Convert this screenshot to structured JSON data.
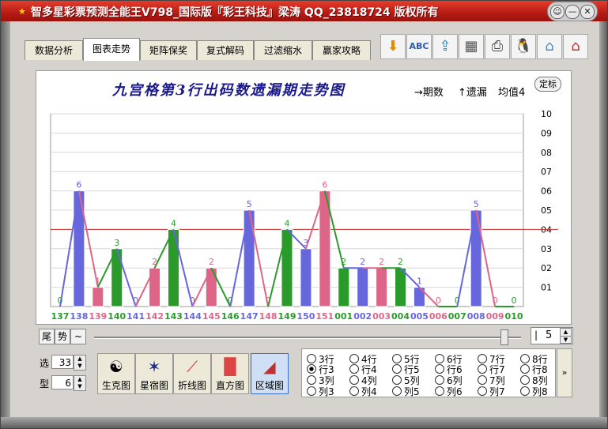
{
  "window": {
    "title": "智多星彩票预测全能王V798_国际版『彩王科技』梁涛 QQ_23818724 版权所有",
    "buttons": [
      "☺",
      "—",
      "✕"
    ]
  },
  "tabs": [
    "数据分析",
    "图表走势",
    "矩阵保奖",
    "复式解码",
    "过滤缩水",
    "赢家攻略"
  ],
  "active_tab": 1,
  "toolbar_icons": [
    "down-arrow-icon",
    "spellcheck-icon",
    "export-icon",
    "calculator-icon",
    "printer-icon",
    "qq-penguin-icon",
    "basket-icon",
    "home-icon"
  ],
  "chart": {
    "title": "九宫格第3行出码数遗漏期走势图",
    "note_period": "→期数",
    "note_missing": "↑遗漏",
    "note_avg": "均值4",
    "fix_button": "定标"
  },
  "chart_data": {
    "type": "bar",
    "categories": [
      "137",
      "138",
      "139",
      "140",
      "141",
      "142",
      "143",
      "144",
      "145",
      "146",
      "147",
      "148",
      "149",
      "150",
      "151",
      "001",
      "002",
      "003",
      "004",
      "005",
      "006",
      "007",
      "008",
      "009",
      "010"
    ],
    "values": [
      0,
      6,
      1,
      3,
      0,
      2,
      4,
      0,
      2,
      0,
      5,
      0,
      4,
      3,
      6,
      2,
      2,
      2,
      2,
      1,
      0,
      0,
      5,
      0,
      0
    ],
    "series_colors": [
      "#2a9a2a",
      "#6666dd",
      "#dd6688",
      "#2a9a2a",
      "#6666dd",
      "#dd6688",
      "#2a9a2a",
      "#6666dd",
      "#dd6688",
      "#2a9a2a",
      "#6666dd",
      "#dd6688",
      "#2a9a2a",
      "#6666dd",
      "#dd6688",
      "#2a9a2a",
      "#6666dd",
      "#dd6688",
      "#2a9a2a",
      "#6666dd",
      "#dd6688",
      "#2a9a2a",
      "#6666dd",
      "#dd6688",
      "#2a9a2a"
    ],
    "y_ticks": [
      "01",
      "02",
      "03",
      "04",
      "05",
      "06",
      "07",
      "08",
      "09",
      "10"
    ],
    "ylim": [
      0,
      10
    ],
    "average": 4,
    "average_line_color": "#c83030",
    "grid": true
  },
  "controls": {
    "btn_tail": "尾",
    "btn_trend": "势",
    "btn_tilde": "~",
    "spin_value": "5",
    "spin_prefix": "|",
    "label_select": "选",
    "select_value": "33",
    "label_type": "型",
    "type_value": "6"
  },
  "chart_buttons": [
    {
      "label": "生克图",
      "icon": "yin-yang-icon"
    },
    {
      "label": "星宿图",
      "icon": "star-icon"
    },
    {
      "label": "折线图",
      "icon": "line-chart-icon"
    },
    {
      "label": "直方图",
      "icon": "histogram-icon"
    },
    {
      "label": "区域图",
      "icon": "area-chart-icon"
    }
  ],
  "active_chart_button": 4,
  "radio_groups": [
    [
      "3行",
      "行3",
      "3列",
      "列3"
    ],
    [
      "4行",
      "行4",
      "4列",
      "列4"
    ],
    [
      "5行",
      "行5",
      "5列",
      "列5"
    ],
    [
      "6行",
      "行6",
      "6列",
      "列6"
    ],
    [
      "7行",
      "行7",
      "7列",
      "列7"
    ],
    [
      "8行",
      "行8",
      "8列",
      "列8"
    ]
  ],
  "selected_radio": "行3",
  "more_button": "»"
}
